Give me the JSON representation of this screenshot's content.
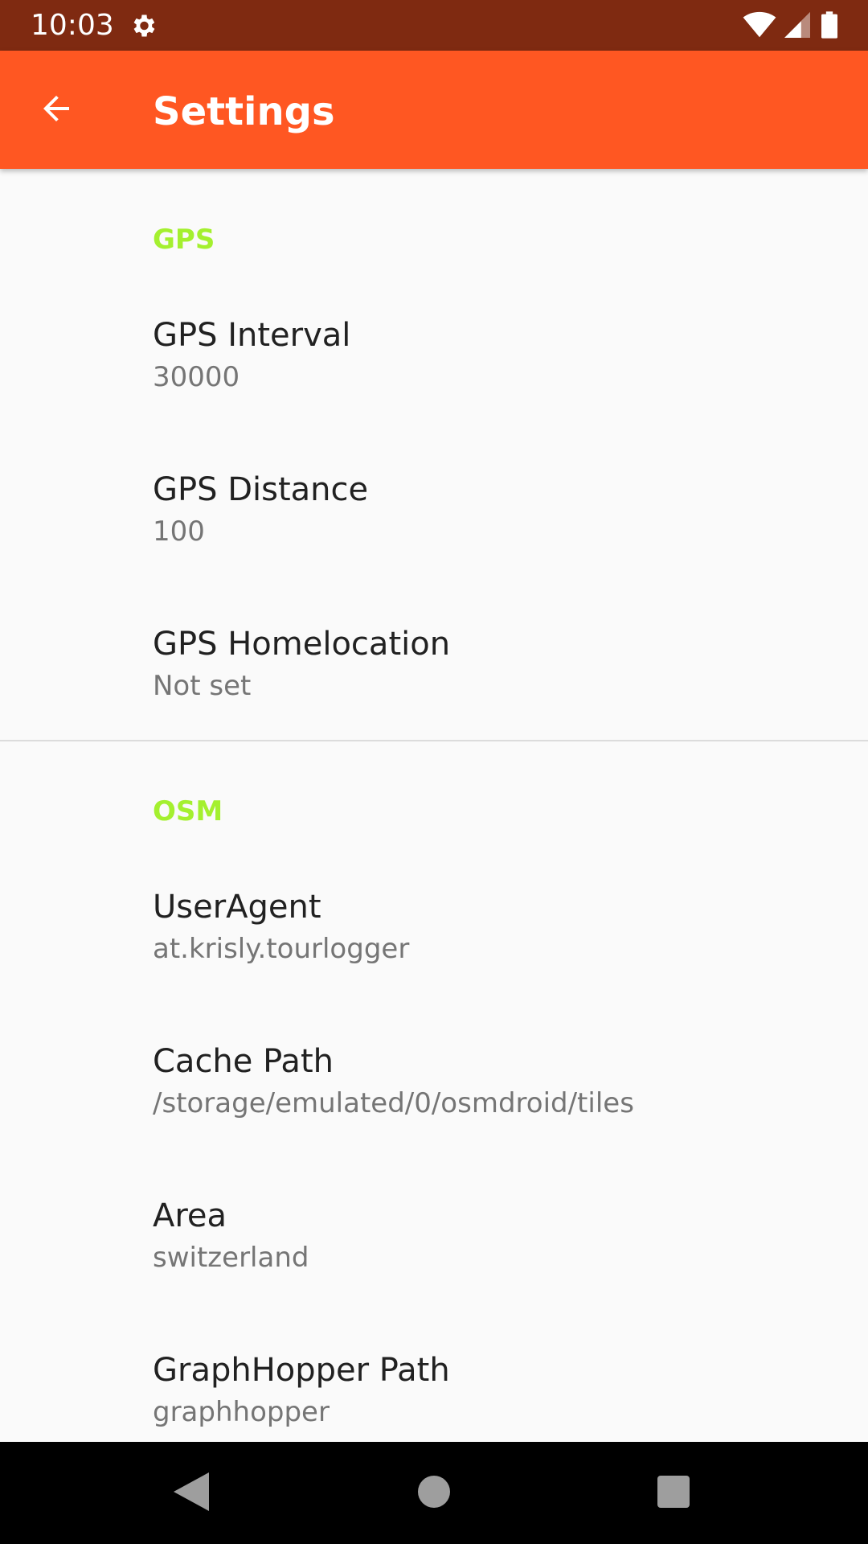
{
  "status_bar": {
    "time": "10:03",
    "icons": [
      "gear-icon",
      "wifi-icon",
      "cell-signal-icon",
      "battery-icon"
    ]
  },
  "app_bar": {
    "title": "Settings",
    "back_icon": "arrow-left-icon",
    "background": "#ff5722"
  },
  "sections": [
    {
      "title": "GPS",
      "items": [
        {
          "title": "GPS Interval",
          "summary": "30000"
        },
        {
          "title": "GPS Distance",
          "summary": "100"
        },
        {
          "title": "GPS Homelocation",
          "summary": "Not set"
        }
      ]
    },
    {
      "title": "OSM",
      "items": [
        {
          "title": "UserAgent",
          "summary": "at.krisly.tourlogger"
        },
        {
          "title": "Cache Path",
          "summary": "/storage/emulated/0/osmdroid/tiles"
        },
        {
          "title": "Area",
          "summary": "switzerland"
        },
        {
          "title": "GraphHopper Path",
          "summary": "graphhopper"
        }
      ]
    }
  ],
  "nav_bar": {
    "icons": [
      "back-triangle-icon",
      "home-circle-icon",
      "recents-square-icon"
    ]
  },
  "colors": {
    "status_bar": "#7f2a11",
    "accent": "#a4f02f",
    "title_text": "#212121",
    "summary_text": "#757575"
  }
}
